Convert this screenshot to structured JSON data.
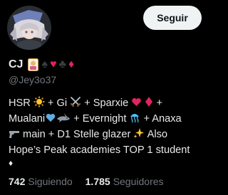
{
  "profile": {
    "display_name": "CJ",
    "handle": "@Jey3o37",
    "follow_label": "Seguir",
    "suits": {
      "spade": "♠",
      "heart": "♥",
      "club": "♣",
      "diamond": "♦"
    },
    "bio": {
      "line1": {
        "a": "HSR ",
        "b": " + Gi ",
        "c": " + Sparxie ",
        "d": " + "
      },
      "line2": {
        "a": "Mualani",
        "b": " + Evernight ",
        "c": " + Anaxa"
      },
      "line3": {
        "a": " main + D1 Stelle glazer ",
        "b": " Also"
      },
      "line4": "Hope’s Peak academies TOP 1 student",
      "line5": "♦"
    },
    "stats": {
      "following_count": "742",
      "following_label": "Siguiendo",
      "followers_count": "1.785",
      "followers_label": "Seguidores"
    }
  },
  "colors": {
    "background": "#000000",
    "text": "#e7e9ea",
    "muted": "#71767b",
    "button_bg": "#eff3f4",
    "heart": "#e0245e"
  },
  "icons": [
    "avatar",
    "card-badge-icon",
    "spade-icon",
    "heart-icon",
    "club-icon",
    "diamond-icon",
    "sun-icon",
    "crossed-swords-icon",
    "blue-heart-icon",
    "shark-icon",
    "jellyfish-icon",
    "pistol-icon",
    "sparkles-icon"
  ]
}
